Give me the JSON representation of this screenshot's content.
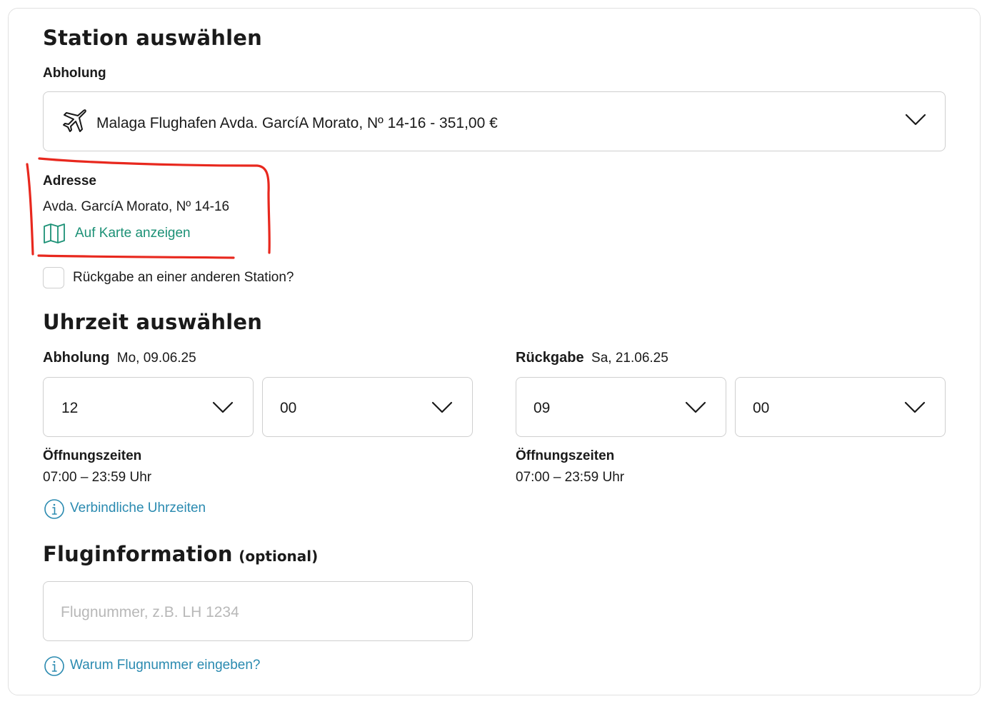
{
  "station": {
    "title": "Station auswählen",
    "pickup_label": "Abholung",
    "pickup_value": "Malaga Flughafen Avda. GarcíA Morato, Nº 14-16 - 351,00 €",
    "pickup_icon": "airplane-icon",
    "address_label": "Adresse",
    "address_value": "Avda. GarcíA Morato, Nº 14-16",
    "map_link": "Auf Karte anzeigen",
    "map_icon": "map-icon",
    "return_other_label": "Rückgabe an einer anderen Station?",
    "return_other_checked": false
  },
  "time": {
    "title": "Uhrzeit auswählen",
    "pickup": {
      "label": "Abholung",
      "date": "Mo, 09.06.25",
      "hour": "12",
      "minute": "00",
      "opening_label": "Öffnungszeiten",
      "opening_hours": "07:00 – 23:59 Uhr"
    },
    "return": {
      "label": "Rückgabe",
      "date": "Sa, 21.06.25",
      "hour": "09",
      "minute": "00",
      "opening_label": "Öffnungszeiten",
      "opening_hours": "07:00 – 23:59 Uhr"
    },
    "binding_link": "Verbindliche Uhrzeiten"
  },
  "flight": {
    "title": "Fluginformation",
    "optional": "(optional)",
    "placeholder": "Flugnummer, z.B. LH 1234",
    "why_link": "Warum Flugnummer eingeben?"
  },
  "colors": {
    "teal_link": "#1c9176",
    "blue_link": "#2a8ab0",
    "annotation_red": "#e8281e",
    "border": "#cfcfcf"
  }
}
